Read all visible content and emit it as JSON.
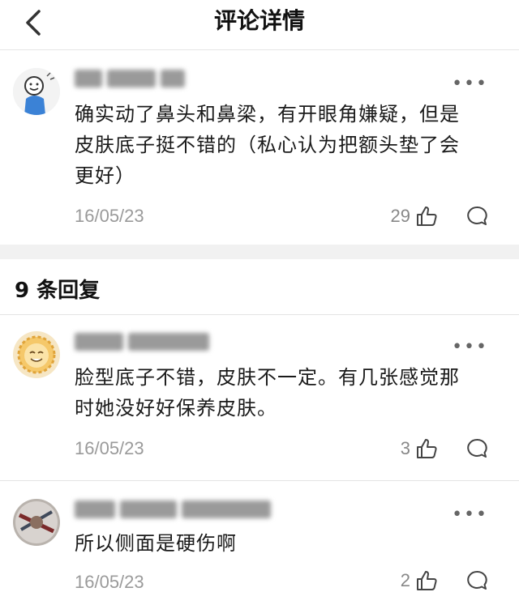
{
  "header": {
    "title": "评论详情"
  },
  "main_comment": {
    "text_lines": [
      "确实动了鼻头和鼻梁，有开眼角嫌疑，但是",
      "皮肤底子挺不错的（私心认为把额头垫了会",
      "更好）"
    ],
    "date": "16/05/23",
    "likes": "29"
  },
  "replies_section": {
    "title": "9 条回复"
  },
  "replies": [
    {
      "text_lines": [
        "脸型底子不错，皮肤不一定。有几张感觉那",
        "时她没好好保养皮肤。"
      ],
      "date": "16/05/23",
      "likes": "3"
    },
    {
      "text_lines": [
        "所以侧面是硬伤啊"
      ],
      "date": "16/05/23",
      "likes": "2"
    }
  ],
  "icons": {
    "back": "chevron-left-icon",
    "more": "more-dots-icon",
    "like": "thumbs-up-icon",
    "reply": "comment-bubble-icon"
  },
  "colors": {
    "muted_text": "#9a9a9a",
    "divider": "#e3e3e3",
    "section_bg": "#f1f1f1"
  }
}
